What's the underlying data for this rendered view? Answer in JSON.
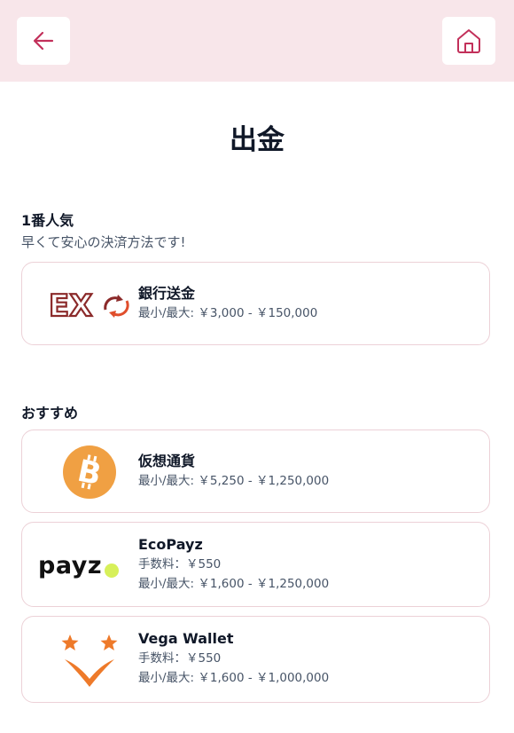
{
  "page": {
    "title": "出金"
  },
  "nav": {
    "back_icon": "arrow-left-icon",
    "home_icon": "home-icon",
    "accent": "#c2305a",
    "bar_color": "#f8e6ea"
  },
  "sections": {
    "popular": {
      "title": "1番人気",
      "subtitle": "早くて安心の決済方法です!",
      "items": [
        {
          "name": "銀行送金",
          "limits": "最小/最大: ￥3,000 - ￥150,000",
          "logo_text": "EX",
          "logo_icon": "exchange-arrows-icon"
        }
      ]
    },
    "recommended": {
      "title": "おすすめ",
      "items": [
        {
          "name": "仮想通貨",
          "limits": "最小/最大: ￥5,250 - ￥1,250,000",
          "logo_icon": "bitcoin-icon",
          "logo_color": "#f0a043"
        },
        {
          "name": "EcoPayz",
          "fee": "手数料：￥550",
          "limits": "最小/最大: ￥1,600 - ￥1,250,000",
          "logo_text": "payz",
          "dot_color": "#d7f05a"
        },
        {
          "name": "Vega Wallet",
          "fee": "手数料：￥550",
          "limits": "最小/最大: ￥1,600 - ￥1,000,000",
          "logo_icon": "vega-stars-icon",
          "logo_color": "#ee7a2a"
        }
      ]
    }
  }
}
